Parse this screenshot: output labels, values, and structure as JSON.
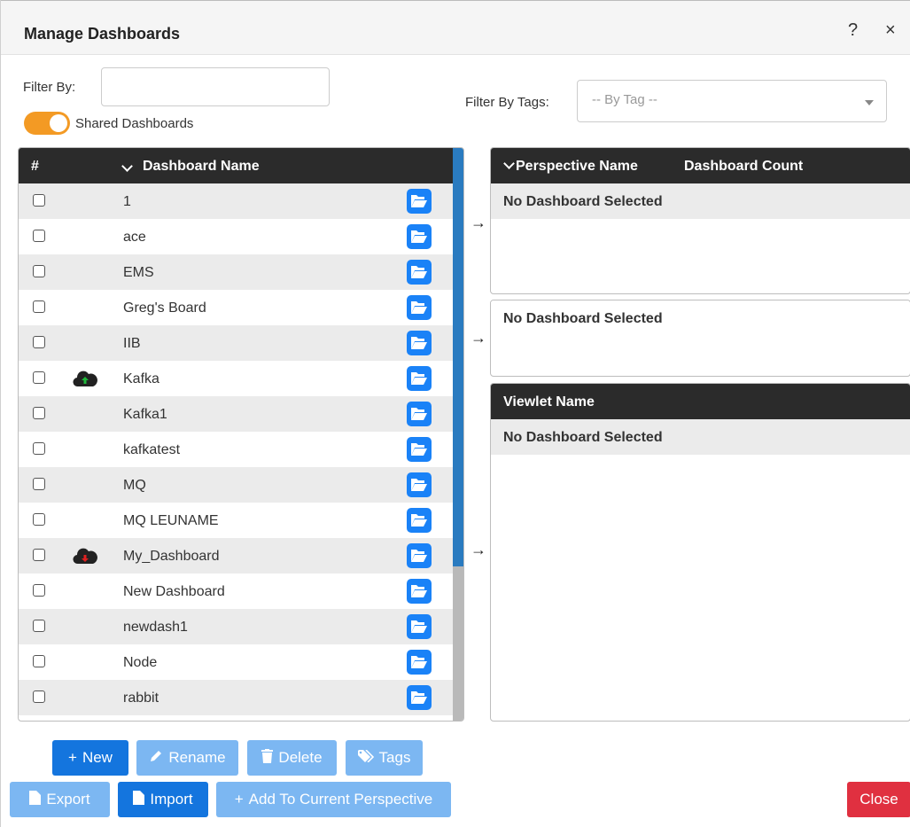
{
  "dialog": {
    "title": "Manage Dashboards",
    "help": "?",
    "close": "×"
  },
  "filter": {
    "label": "Filter By:",
    "value": "",
    "tags_label": "Filter By Tags:",
    "tags_placeholder": "-- By Tag --"
  },
  "shared_toggle": {
    "label": "Shared Dashboards",
    "on": true
  },
  "table": {
    "col_hash": "#",
    "col_name": "Dashboard Name",
    "rows": [
      {
        "name": "1",
        "cloud": ""
      },
      {
        "name": "ace",
        "cloud": ""
      },
      {
        "name": "EMS",
        "cloud": ""
      },
      {
        "name": "Greg's Board",
        "cloud": ""
      },
      {
        "name": "IIB",
        "cloud": ""
      },
      {
        "name": "Kafka",
        "cloud": "upload-cloud-icon"
      },
      {
        "name": "Kafka1",
        "cloud": ""
      },
      {
        "name": "kafkatest",
        "cloud": ""
      },
      {
        "name": "MQ",
        "cloud": ""
      },
      {
        "name": "MQ LEUNAME",
        "cloud": ""
      },
      {
        "name": "My_Dashboard",
        "cloud": "download-cloud-icon"
      },
      {
        "name": "New Dashboard",
        "cloud": ""
      },
      {
        "name": "newdash1",
        "cloud": ""
      },
      {
        "name": "Node",
        "cloud": ""
      },
      {
        "name": "rabbit",
        "cloud": ""
      }
    ]
  },
  "perspective_panel": {
    "col_name": "Perspective Name",
    "col_count": "Dashboard Count",
    "message": "No Dashboard Selected"
  },
  "middle_panel": {
    "message": "No Dashboard Selected"
  },
  "viewlet_panel": {
    "col_name": "Viewlet Name",
    "message": "No Dashboard Selected"
  },
  "buttons": {
    "new": "New",
    "rename": "Rename",
    "delete": "Delete",
    "tags": "Tags",
    "export": "Export",
    "import": "Import",
    "add_to_perspective": "Add To Current Perspective",
    "close": "Close"
  },
  "colors": {
    "primary": "#1475de",
    "primary_light": "#7cb7f2",
    "danger": "#e03040",
    "toggle": "#f39a24",
    "header": "#2b2b2b"
  }
}
